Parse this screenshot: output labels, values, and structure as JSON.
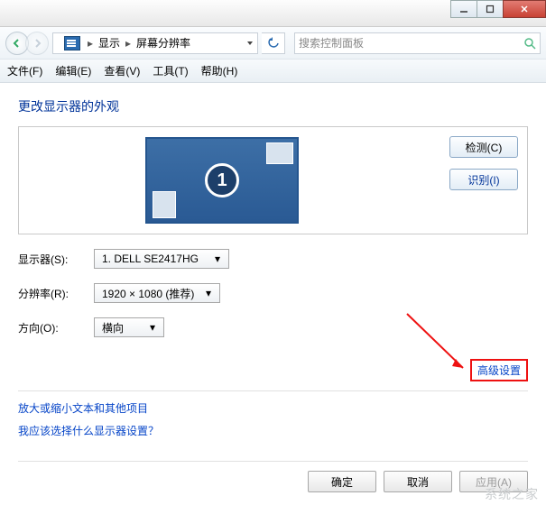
{
  "titlebar": {
    "min": "",
    "max": "",
    "close": ""
  },
  "nav": {
    "crumb1": "显示",
    "crumb2": "屏幕分辨率",
    "search_placeholder": "搜索控制面板"
  },
  "menu": {
    "file": "文件(F)",
    "edit": "编辑(E)",
    "view": "查看(V)",
    "tools": "工具(T)",
    "help": "帮助(H)"
  },
  "page": {
    "title": "更改显示器的外观",
    "monitor_number": "1",
    "detect": "检测(C)",
    "identify": "识别(I)",
    "display_label": "显示器(S):",
    "display_value": "1. DELL SE2417HG",
    "resolution_label": "分辨率(R):",
    "resolution_value": "1920 × 1080 (推荐)",
    "orientation_label": "方向(O):",
    "orientation_value": "横向",
    "advanced": "高级设置",
    "link1": "放大或缩小文本和其他项目",
    "link2": "我应该选择什么显示器设置？"
  },
  "footer": {
    "ok": "确定",
    "cancel": "取消",
    "apply": "应用(A)"
  },
  "watermark": "系统之家"
}
